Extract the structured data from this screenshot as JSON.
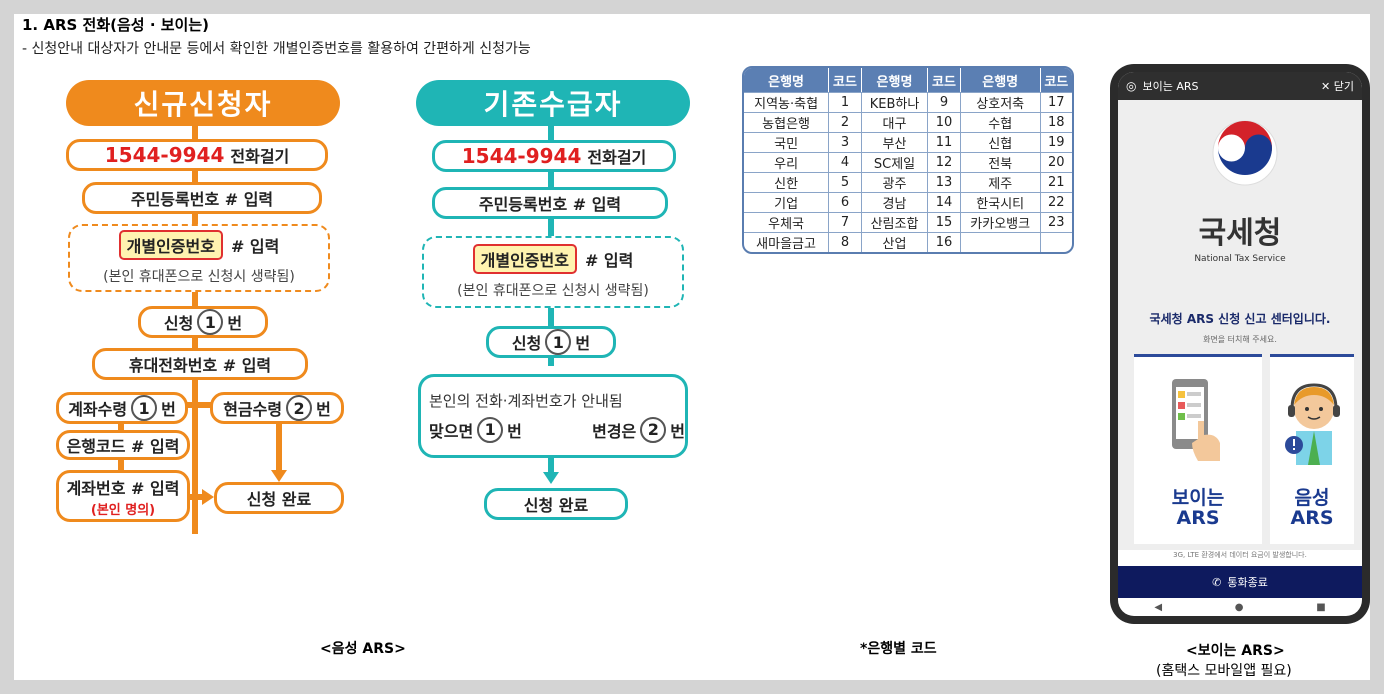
{
  "heading": "1. ARS 전화(음성 · 보이는)",
  "subline": "- 신청안내 대상자가 안내문 등에서 확인한 개별인증번호를 활용하여 간편하게 신청가능",
  "new_flow": {
    "title": "신규신청자",
    "phone": "1544-9944",
    "call": "전화걸기",
    "step_rrn": "주민등록번호 # 입력",
    "auth_code": "개별인증번호",
    "auth_input": "# 입력",
    "auth_note": "(본인 휴대폰으로 신청시 생략됨)",
    "apply_a": "신청",
    "apply_b": "번",
    "mobile_input": "휴대전화번호 # 입력",
    "account_a": "계좌수령",
    "account_b": "번",
    "cash_a": "현금수령",
    "cash_b": "번",
    "bank_code": "은행코드 # 입력",
    "account_no": "계좌번호 # 입력",
    "own_name": "(본인 명의)",
    "done": "신청 완료",
    "n1": "1",
    "n2": "2"
  },
  "existing_flow": {
    "title": "기존수급자",
    "phone": "1544-9944",
    "call": "전화걸기",
    "step_rrn": "주민등록번호 # 입력",
    "auth_code": "개별인증번호",
    "auth_input": "# 입력",
    "auth_note": "(본인 휴대폰으로 신청시 생략됨)",
    "apply_a": "신청",
    "apply_b": "번",
    "info": "본인의 전화·계좌번호가 안내됨",
    "correct_a": "맞으면",
    "correct_b": "번",
    "change_a": "변경은",
    "n1": "1",
    "n2": "2",
    "done": "신청 완료"
  },
  "bank_table": {
    "headers": [
      "은행명",
      "코드",
      "은행명",
      "코드",
      "은행명",
      "코드"
    ],
    "rows": [
      [
        "지역농·축협",
        "1",
        "KEB하나",
        "9",
        "상호저축",
        "17"
      ],
      [
        "농협은행",
        "2",
        "대구",
        "10",
        "수협",
        "18"
      ],
      [
        "국민",
        "3",
        "부산",
        "11",
        "신협",
        "19"
      ],
      [
        "우리",
        "4",
        "SC제일",
        "12",
        "전북",
        "20"
      ],
      [
        "신한",
        "5",
        "광주",
        "13",
        "제주",
        "21"
      ],
      [
        "기업",
        "6",
        "경남",
        "14",
        "한국시티",
        "22"
      ],
      [
        "우체국",
        "7",
        "산림조합",
        "15",
        "카카오뱅크",
        "23"
      ],
      [
        "새마을금고",
        "8",
        "산업",
        "16",
        "",
        ""
      ]
    ]
  },
  "captions": {
    "voice": "<음성 ARS>",
    "bank": "*은행별 코드",
    "visible": "<보이는 ARS>",
    "visible_note": "(홈택스 모바일앱 필요)"
  },
  "phone_ui": {
    "header": "보이는 ARS",
    "close": "닫기",
    "org": "국세청",
    "org_en": "National Tax Service",
    "welcome": "국세청 ARS 신청 신고 센터입니다.",
    "hint": "화면을 터치해 주세요.",
    "visible_a": "보이는",
    "visible_b": "ARS",
    "voice_a": "음성",
    "voice_b": "ARS",
    "data_note": "3G, LTE 환경에서 데이터 요금이 발생합니다.",
    "end_call": "통화종료"
  },
  "colors": {
    "orange": "#ef8a1d",
    "teal": "#1fb5b5",
    "table_header": "#5b7fb3",
    "navy": "#0e1a5e"
  }
}
